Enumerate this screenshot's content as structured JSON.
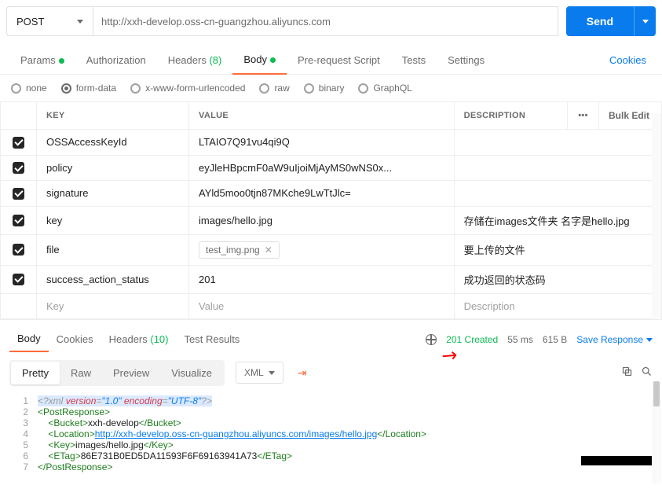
{
  "request": {
    "method": "POST",
    "url": "http://xxh-develop.oss-cn-guangzhou.aliyuncs.com",
    "send_label": "Send"
  },
  "tabs": {
    "items": [
      {
        "label": "Params",
        "dot": true
      },
      {
        "label": "Authorization"
      },
      {
        "label": "Headers",
        "count": "(8)"
      },
      {
        "label": "Body",
        "dot": true,
        "active": true
      },
      {
        "label": "Pre-request Script"
      },
      {
        "label": "Tests"
      },
      {
        "label": "Settings"
      }
    ],
    "cookies": "Cookies"
  },
  "body_types": [
    {
      "label": "none"
    },
    {
      "label": "form-data",
      "checked": true
    },
    {
      "label": "x-www-form-urlencoded"
    },
    {
      "label": "raw"
    },
    {
      "label": "binary"
    },
    {
      "label": "GraphQL"
    }
  ],
  "table": {
    "headers": {
      "key": "KEY",
      "value": "VALUE",
      "desc": "DESCRIPTION",
      "more": "•••",
      "bulk": "Bulk Edit"
    },
    "rows": [
      {
        "key": "OSSAccessKeyId",
        "value": "LTAIO7Q91vu4qi9Q",
        "desc": ""
      },
      {
        "key": "policy",
        "value": "eyJleHBpcmF0aW9uIjoiMjAyMS0wNS0x...",
        "desc": ""
      },
      {
        "key": "signature",
        "value": "AYld5moo0tjn87MKche9LwTtJlc=",
        "desc": ""
      },
      {
        "key": "key",
        "value": "images/hello.jpg",
        "desc": "存储在images文件夹  名字是hello.jpg"
      },
      {
        "key": "file",
        "file": "test_img.png",
        "desc": "要上传的文件"
      },
      {
        "key": "success_action_status",
        "value": "201",
        "desc": "成功返回的状态码"
      }
    ],
    "placeholder": {
      "key": "Key",
      "value": "Value",
      "desc": "Description"
    }
  },
  "response": {
    "tabs": [
      {
        "label": "Body",
        "active": true
      },
      {
        "label": "Cookies"
      },
      {
        "label": "Headers",
        "count": "(10)"
      },
      {
        "label": "Test Results"
      }
    ],
    "status": "201 Created",
    "time": "55 ms",
    "size": "615 B",
    "save": "Save Response",
    "views": [
      {
        "label": "Pretty",
        "active": true
      },
      {
        "label": "Raw"
      },
      {
        "label": "Preview"
      },
      {
        "label": "Visualize"
      }
    ],
    "format": "XML",
    "code": {
      "l1_a": "<?xml ",
      "l1_b": "version",
      "l1_c": "=",
      "l1_d": "\"1.0\"",
      "l1_e": " encoding",
      "l1_f": "=",
      "l1_g": "\"UTF-8\"",
      "l1_h": "?>",
      "l2_o": "<PostResponse>",
      "l3_o": "    <Bucket>",
      "l3_t": "xxh-develop",
      "l3_c": "</Bucket>",
      "l4_o": "    <Location>",
      "l4_t": "http://xxh-develop.oss-cn-guangzhou.aliyuncs.com/images/hello.jpg",
      "l4_c": "</Location>",
      "l5_o": "    <Key>",
      "l5_t": "images/hello.jpg",
      "l5_c": "</Key>",
      "l6_o": "    <ETag>",
      "l6_t": "86E731B0ED5DA11593F6F69163941A73",
      "l6_c": "</ETag>",
      "l7_c": "</PostResponse>"
    }
  }
}
